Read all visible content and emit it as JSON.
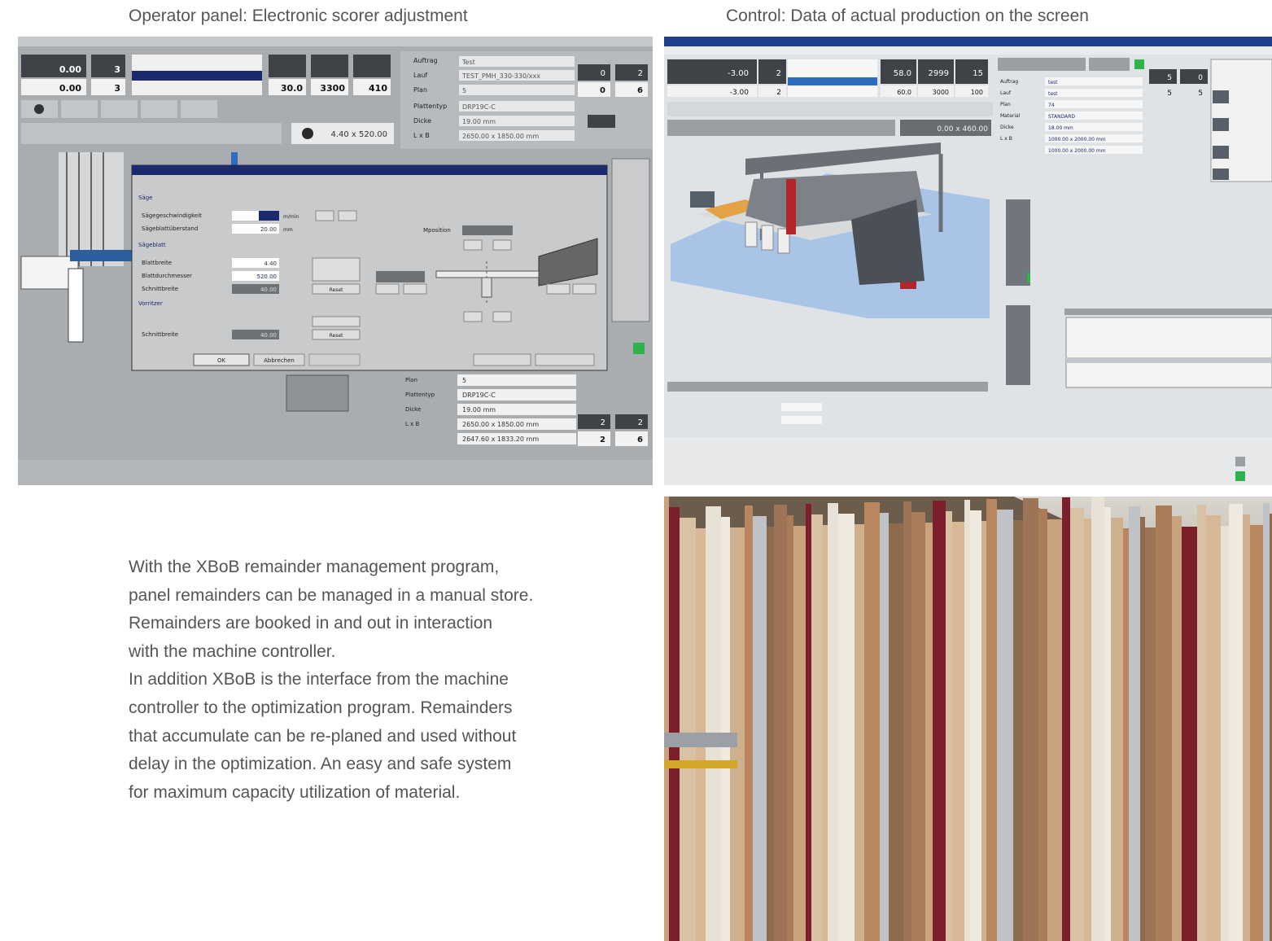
{
  "captions": {
    "left": "Operator panel: Electronic scorer adjustment",
    "right": "Control: Data of actual production on the screen"
  },
  "operator_panel": {
    "values": {
      "pos_a": "0.00",
      "pos_b": "0.00",
      "count_a": "3",
      "count_b": "3",
      "v1": "30.0",
      "v2": "3300",
      "v3": "410",
      "num_a": "0",
      "num_b": "0",
      "num_c": "2",
      "num_d": "6",
      "dim": "4.40 x 520.00"
    },
    "fields": {
      "auftrag_label": "Auftrag",
      "auftrag_value": "Test",
      "lauf_label": "Lauf",
      "lauf_value": "TEST_PMH_330-330/xxx",
      "plan_label": "Plan",
      "plan_value": "5",
      "plattentyp_label": "Plattentyp",
      "plattentyp_value": "DRP19C-C",
      "dicke_label": "Dicke",
      "dicke_value": "19.00 mm",
      "lxb_label": "L x B",
      "lxb_value": "2650.00 x 1850.00 mm"
    },
    "dialog": {
      "section_saege": "Säge",
      "saegegeschwindigkeit": "Sägegeschwindigkeit",
      "saegeblattueberstand": "Sägeblattüberstand",
      "val_ueberstand": "20.00",
      "section_blatt": "Sägeblatt",
      "blattbreite": "Blattbreite",
      "val_blattbreite": "4.40",
      "blattdurchmesser": "Blattdurchmesser",
      "val_durchmesser": "520.00",
      "schnittbreite": "Schnittbreite",
      "val_schnitt": "40.00",
      "section_vorritzer": "Vorritzer",
      "schnittbreite2": "Schnittbreite",
      "val_schnitt2": "40.00",
      "mposition": "Mposition",
      "ok": "OK",
      "abbrechen": "Abbrechen",
      "reset": "Reset",
      "unit_mm": "mm",
      "unit_mmin": "m/min"
    },
    "lower": {
      "plan": "5",
      "plattentyp": "DRP19C-C",
      "dicke": "19.00 mm",
      "lxb": "2650.00 x 1850.00 mm",
      "fert": "2647.60 x 1833.20 mm",
      "n1": "2",
      "n2": "2",
      "n3": "2",
      "n4": "6"
    }
  },
  "control_screen": {
    "values": {
      "a": "-3.00",
      "b": "-3.00",
      "c": "2",
      "d": "2",
      "e": "58.0",
      "f": "2999",
      "g": "15",
      "h": "60.0",
      "i": "3000",
      "j": "100",
      "k": "5",
      "l": "0",
      "m": "5",
      "n": "5",
      "dim": "0.00 x 460.00"
    },
    "fields": {
      "auftrag": "test",
      "lauf": "test",
      "plan": "74",
      "material": "STANDARD",
      "dicke": "18.00 mm",
      "lxb": "1000.00 x 2000.00 mm",
      "min_lxb": "1000.00 x 2000.00 mm",
      "dicke_label": "Dicke",
      "plan_label": "Plan",
      "material_label": "Material",
      "auftrag_label": "Auftrag",
      "lauf_label": "Lauf",
      "lxb_label": "L x B"
    }
  },
  "body_text": [
    "With the XBoB remainder management program,",
    "panel remainders can be managed in a manual store.",
    "Remainders are booked in and out in interaction",
    "with the machine controller.",
    "In addition XBoB is the interface from the machine",
    "controller to the optimization program. Remainders",
    "that accumulate can be re-planed and used without",
    "delay in the optimization. An easy and safe system",
    "for maximum capacity utilization of material."
  ],
  "colors": {
    "text_gray": "#555555",
    "panel_gray": "#a9adb0",
    "dark_box": "#3f4347",
    "navy": "#1a2a6c",
    "screen_green": "#2fb24b",
    "machine_red": "#b3262b",
    "floor_blue": "#a9c4e6"
  }
}
